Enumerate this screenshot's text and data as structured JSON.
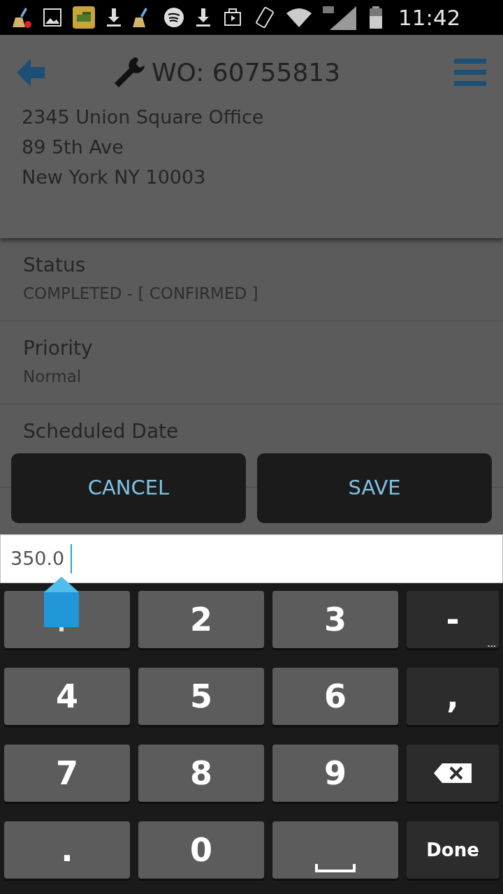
{
  "status_bar": {
    "time": "11:42"
  },
  "header": {
    "title": "WO: 60755813",
    "address": [
      "2345 Union Square Office",
      "89 5th Ave",
      "New York NY 10003"
    ]
  },
  "fields": [
    {
      "label": "Status",
      "value": "COMPLETED - [ CONFIRMED ]"
    },
    {
      "label": "Priority",
      "value": "Normal"
    },
    {
      "label": "Scheduled Date"
    }
  ],
  "dialog_buttons": [
    "CANCEL",
    "SAVE"
  ],
  "input": {
    "value": "350.0"
  },
  "keyboard": [
    [
      {
        "kind": "covered"
      },
      {
        "kind": "char",
        "label": "2"
      },
      {
        "kind": "char",
        "label": "3"
      },
      {
        "kind": "fn",
        "label": "-",
        "hint": "..."
      }
    ],
    [
      {
        "kind": "char",
        "label": "4"
      },
      {
        "kind": "char",
        "label": "5"
      },
      {
        "kind": "char",
        "label": "6"
      },
      {
        "kind": "fn",
        "label": ","
      }
    ],
    [
      {
        "kind": "char",
        "label": "7"
      },
      {
        "kind": "char",
        "label": "8"
      },
      {
        "kind": "char",
        "label": "9"
      },
      {
        "kind": "backspace"
      }
    ],
    [
      {
        "kind": "char",
        "label": "."
      },
      {
        "kind": "char",
        "label": "0"
      },
      {
        "kind": "space"
      },
      {
        "kind": "done",
        "label": "Done"
      }
    ]
  ]
}
